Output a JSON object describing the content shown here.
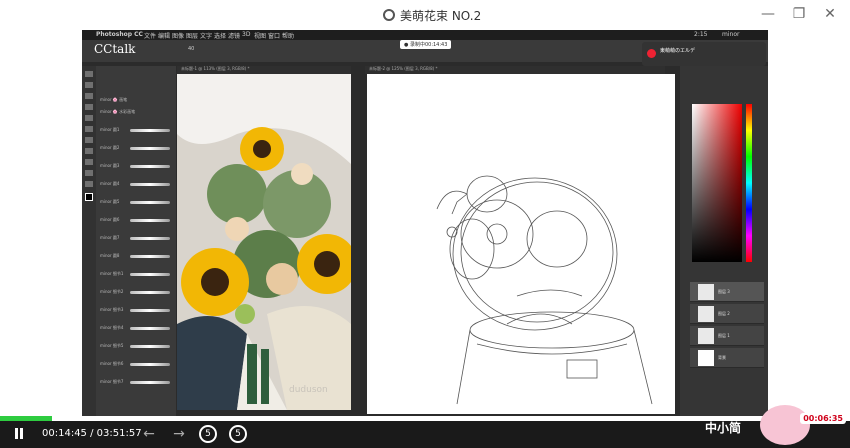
{
  "player": {
    "title": "美萌花束 NO.2",
    "minimize_icon": "minimize-icon",
    "restore_icon": "restore-icon",
    "close_icon": "close-icon"
  },
  "video": {
    "app_name": "Photoshop CC",
    "mac_menu": [
      "文件",
      "编辑",
      "图像",
      "图层",
      "文字",
      "选择",
      "滤镜",
      "3D",
      "视图",
      "窗口",
      "帮助"
    ],
    "watermark_brand": "CCtalk",
    "live_timer": "● 录制中00:14:43",
    "status_right_time": "2:15",
    "status_right_user": "minor",
    "doc1_tab": "未标题-1 @ 113% (图层 3, RGB/8) *",
    "doc2_tab": "未标题-2 @ 125% (图层 3, RGB/8) *",
    "notification_text": "東萌萌のエルデ",
    "photo_watermark": "duduson",
    "brush_size": "40",
    "brush_panel_header": "minor 🌸 预装",
    "brushes": [
      "minor 🌸 画笔",
      "minor 🌸 水彩画笔",
      "minor 圆1",
      "minor 圆2",
      "minor 圆3",
      "minor 圆4",
      "minor 圆5",
      "minor 圆6",
      "minor 圆7",
      "minor 圆8",
      "minor 细节1",
      "minor 细节2",
      "minor 细节3",
      "minor 细节4",
      "minor 细节5",
      "minor 细节6",
      "minor 细节7"
    ],
    "layers": [
      "图层 3",
      "图层 2",
      "图层 1",
      "背景"
    ],
    "selected_layer_index": 0,
    "colors": {
      "ps_bg": "#2b2b2b",
      "flower_yellow": "#f2b705",
      "flower_center": "#3a2410"
    }
  },
  "controls": {
    "current_time": "00:14:45",
    "separator": "/",
    "total_time": "03:51:57",
    "progress_fraction": 0.0635,
    "skip_back_label": "5",
    "skip_forward_label": "5",
    "mascot_text": "中小简",
    "mascot_time": "00:06:35"
  }
}
